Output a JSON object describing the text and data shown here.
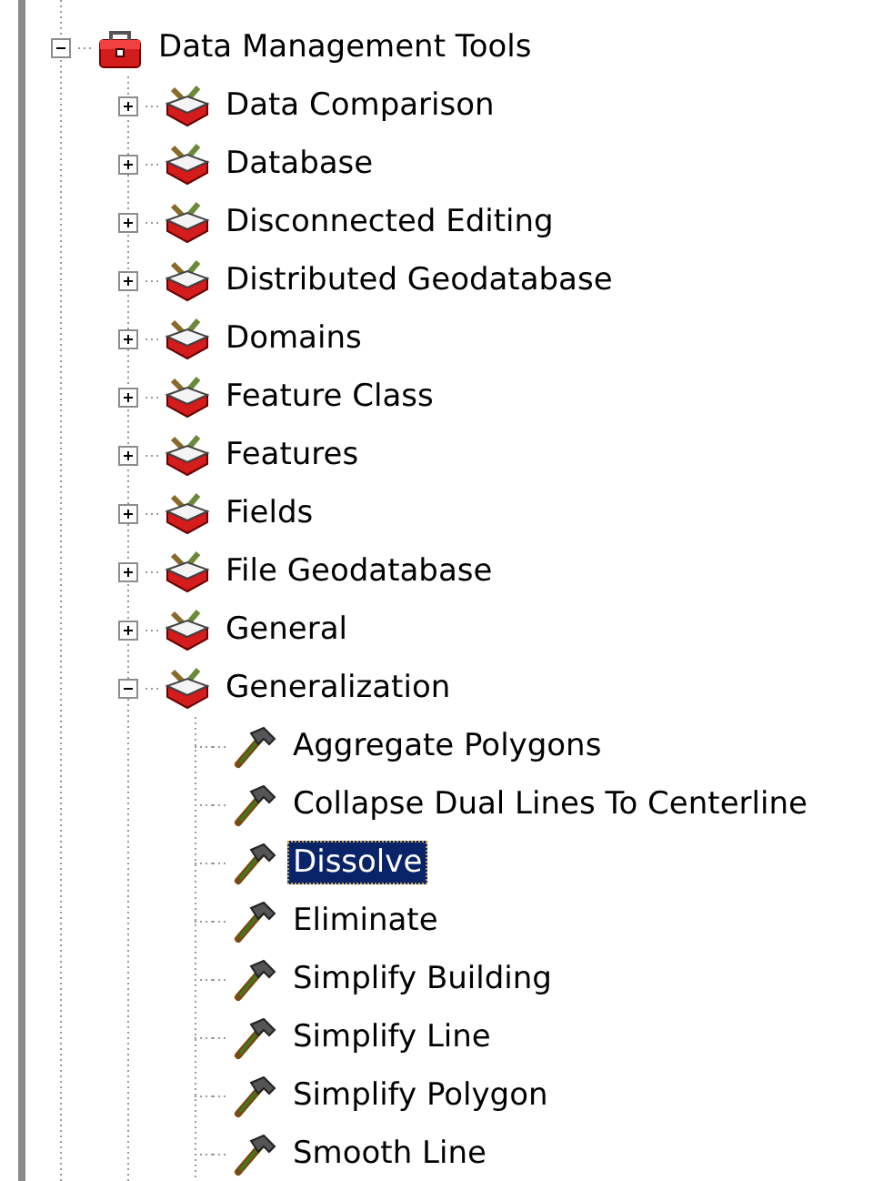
{
  "tree": {
    "label": "Data Management Tools",
    "kind": "toolbox",
    "expanded": true,
    "selected": false,
    "children": [
      {
        "label": "Data Comparison",
        "kind": "toolset",
        "expanded": false,
        "selected": false
      },
      {
        "label": "Database",
        "kind": "toolset",
        "expanded": false,
        "selected": false
      },
      {
        "label": "Disconnected Editing",
        "kind": "toolset",
        "expanded": false,
        "selected": false
      },
      {
        "label": "Distributed Geodatabase",
        "kind": "toolset",
        "expanded": false,
        "selected": false
      },
      {
        "label": "Domains",
        "kind": "toolset",
        "expanded": false,
        "selected": false
      },
      {
        "label": "Feature Class",
        "kind": "toolset",
        "expanded": false,
        "selected": false
      },
      {
        "label": "Features",
        "kind": "toolset",
        "expanded": false,
        "selected": false
      },
      {
        "label": "Fields",
        "kind": "toolset",
        "expanded": false,
        "selected": false
      },
      {
        "label": "File Geodatabase",
        "kind": "toolset",
        "expanded": false,
        "selected": false
      },
      {
        "label": "General",
        "kind": "toolset",
        "expanded": false,
        "selected": false
      },
      {
        "label": "Generalization",
        "kind": "toolset",
        "expanded": true,
        "selected": false,
        "children": [
          {
            "label": "Aggregate Polygons",
            "kind": "tool",
            "selected": false
          },
          {
            "label": "Collapse Dual Lines To Centerline",
            "kind": "tool",
            "selected": false
          },
          {
            "label": "Dissolve",
            "kind": "tool",
            "selected": true
          },
          {
            "label": "Eliminate",
            "kind": "tool",
            "selected": false
          },
          {
            "label": "Simplify Building",
            "kind": "tool",
            "selected": false
          },
          {
            "label": "Simplify Line",
            "kind": "tool",
            "selected": false
          },
          {
            "label": "Simplify Polygon",
            "kind": "tool",
            "selected": false
          },
          {
            "label": "Smooth Line",
            "kind": "tool",
            "selected": false
          }
        ]
      }
    ]
  }
}
